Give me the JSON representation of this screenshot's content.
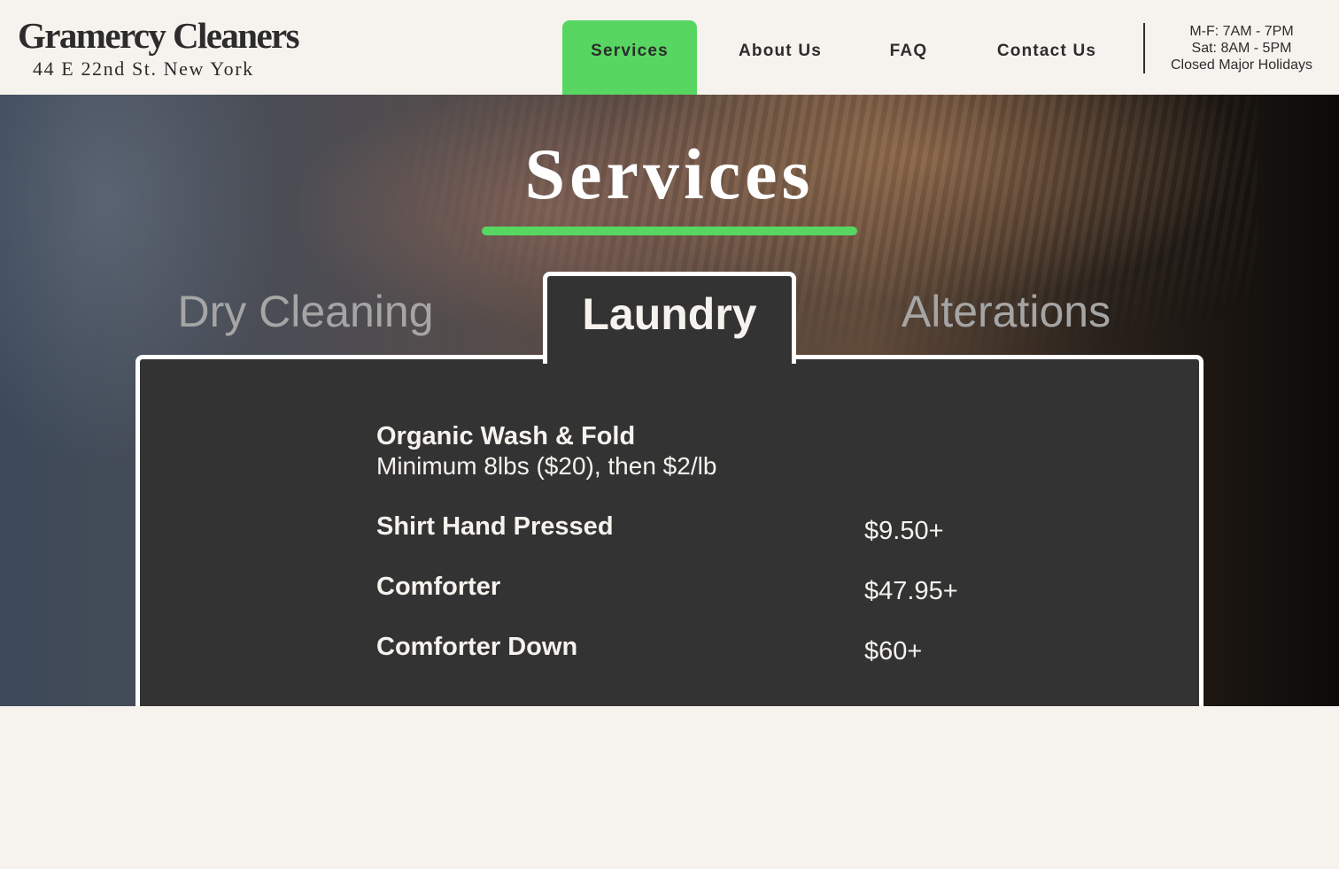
{
  "brand": {
    "name": "Gramercy Cleaners",
    "address": "44 E 22nd St. New York"
  },
  "nav": {
    "services": "Services",
    "about": "About Us",
    "faq": "FAQ",
    "contact": "Contact Us"
  },
  "hours": {
    "weekday": "M-F: 7AM - 7PM",
    "saturday": "Sat: 8AM - 5PM",
    "holidays": "Closed Major Holidays"
  },
  "hero": {
    "title": "Services"
  },
  "tabs": {
    "dry_cleaning": "Dry Cleaning",
    "laundry": "Laundry",
    "alterations": "Alterations"
  },
  "services": {
    "wash_fold": {
      "name": "Organic Wash & Fold",
      "description": "Minimum 8lbs ($20), then $2/lb"
    },
    "shirt": {
      "name": "Shirt Hand Pressed",
      "price": "$9.50+"
    },
    "comforter": {
      "name": "Comforter",
      "price": "$47.95+"
    },
    "comforter_down": {
      "name": "Comforter Down",
      "price": "$60+"
    }
  },
  "colors": {
    "accent": "#57d761",
    "panel": "#333333",
    "background": "#f6f3ee"
  }
}
